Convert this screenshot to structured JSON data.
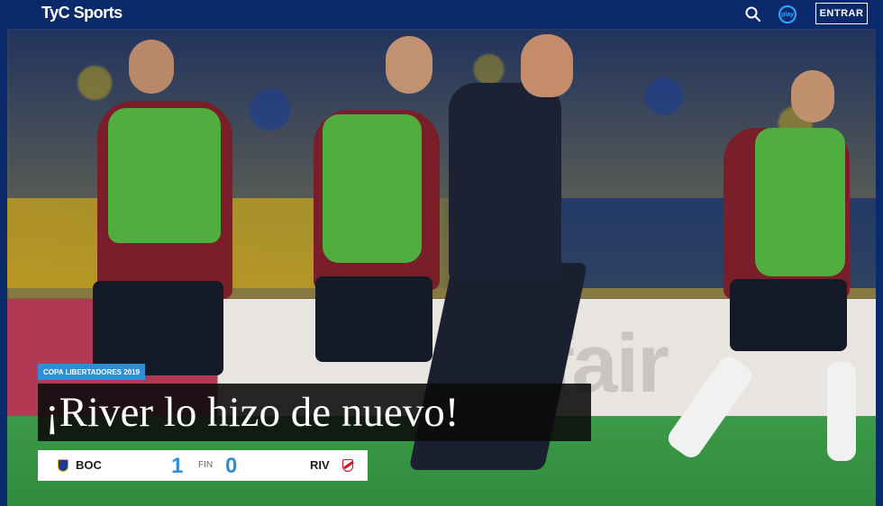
{
  "header": {
    "logo_text": "TyC Sports",
    "play_label": "play",
    "login_label": "ENTRAR"
  },
  "hero": {
    "category_tag": "COPA LIBERTADORES 2019",
    "headline": "¡River lo hizo de nuevo!",
    "ad_text": "etfair"
  },
  "scoreboard": {
    "home_team": "BOC",
    "away_team": "RIV",
    "home_score": "1",
    "away_score": "0",
    "status": "FIN"
  },
  "colors": {
    "header_bg": "#0b2a6b",
    "accent_blue": "#2f8fd6",
    "headline_bg": "#0a0a0a"
  }
}
